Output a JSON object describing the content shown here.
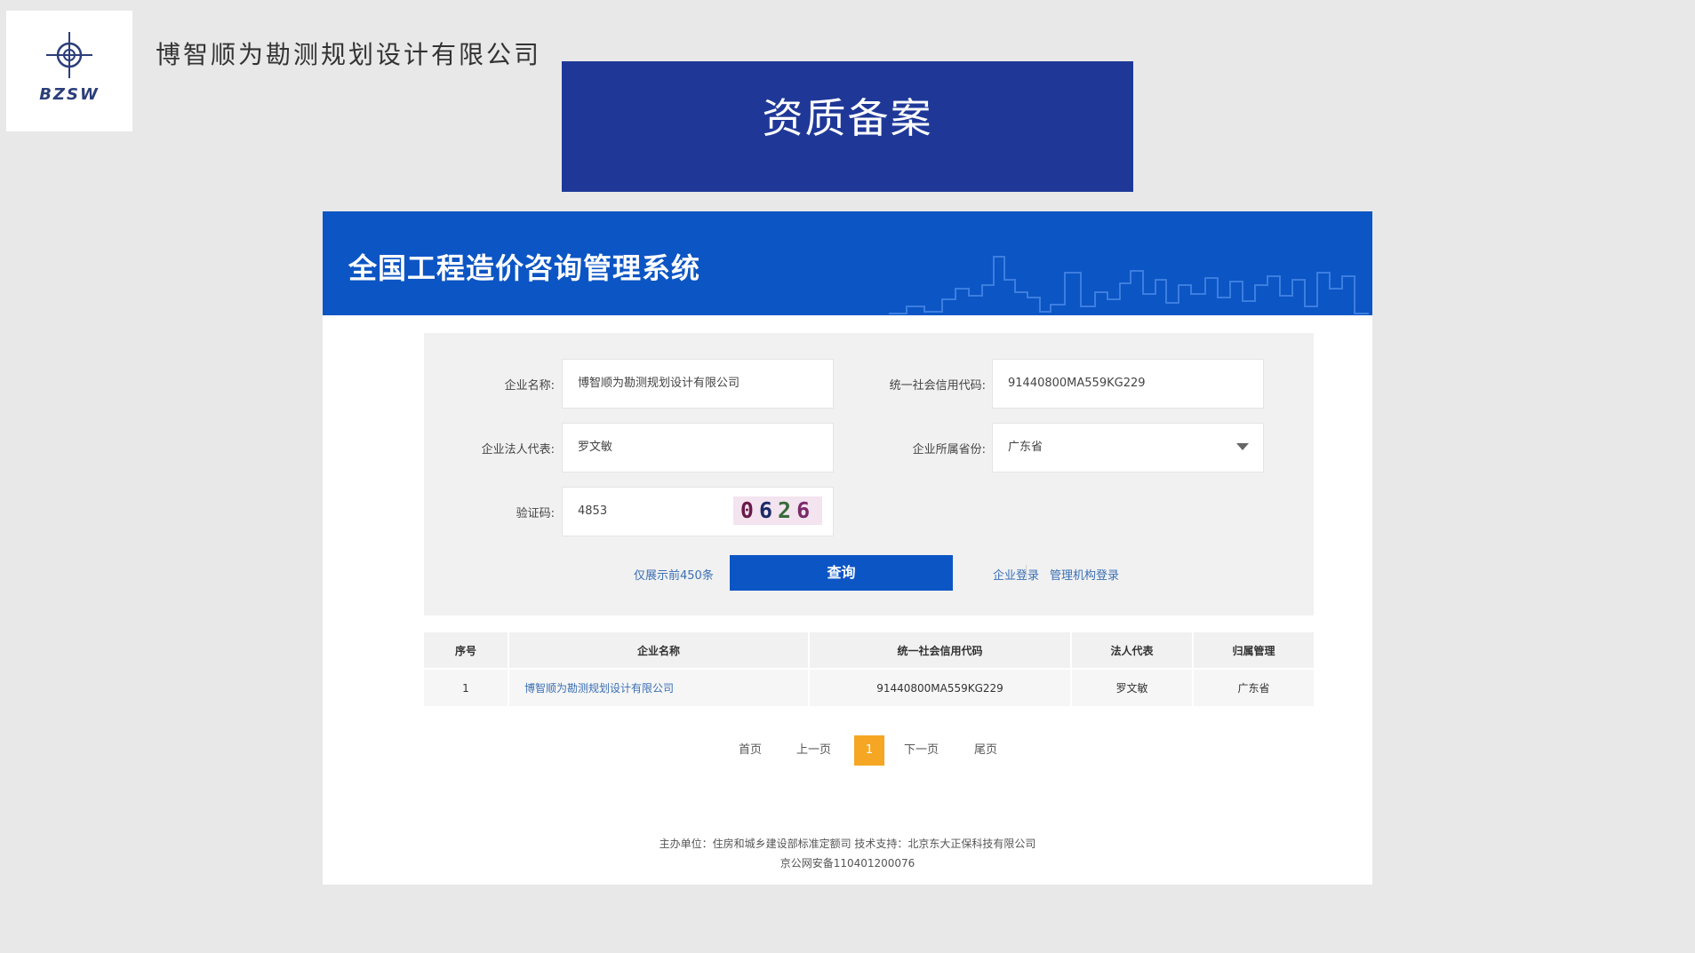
{
  "logo": {
    "text": "BZSW",
    "icon": "crosshair-icon",
    "color": "#2c3e7a"
  },
  "company_heading": "博智顺为勘测规划设计有限公司",
  "title_banner": "资质备案",
  "system": {
    "title": "全国工程造价咨询管理系统",
    "header_color": "#0c55c4"
  },
  "form": {
    "company_name": {
      "label": "企业名称:",
      "value": "博智顺为勘测规划设计有限公司"
    },
    "credit_code": {
      "label": "统一社会信用代码:",
      "value": "91440800MA559KG229"
    },
    "legal_rep": {
      "label": "企业法人代表:",
      "value": "罗文敏"
    },
    "province": {
      "label": "企业所属省份:",
      "value": "广东省"
    },
    "captcha": {
      "label": "验证码:",
      "value": "4853",
      "image_digits": [
        "0",
        "6",
        "2",
        "6"
      ]
    },
    "limit_note": "仅展示前450条",
    "query_button": "查询",
    "company_login": "企业登录",
    "admin_login": "管理机构登录"
  },
  "table": {
    "headers": [
      "序号",
      "企业名称",
      "统一社会信用代码",
      "法人代表",
      "归属管理"
    ],
    "rows": [
      [
        "1",
        "博智顺为勘测规划设计有限公司",
        "91440800MA559KG229",
        "罗文敏",
        "广东省"
      ]
    ]
  },
  "pagination": {
    "first": "首页",
    "prev": "上一页",
    "current": "1",
    "next": "下一页",
    "last": "尾页",
    "active_color": "#f5a623"
  },
  "footer": {
    "line1": "主办单位：住房和城乡建设部标准定额司 技术支持：北京东大正保科技有限公司",
    "line2": "京公网安备110401200076"
  }
}
